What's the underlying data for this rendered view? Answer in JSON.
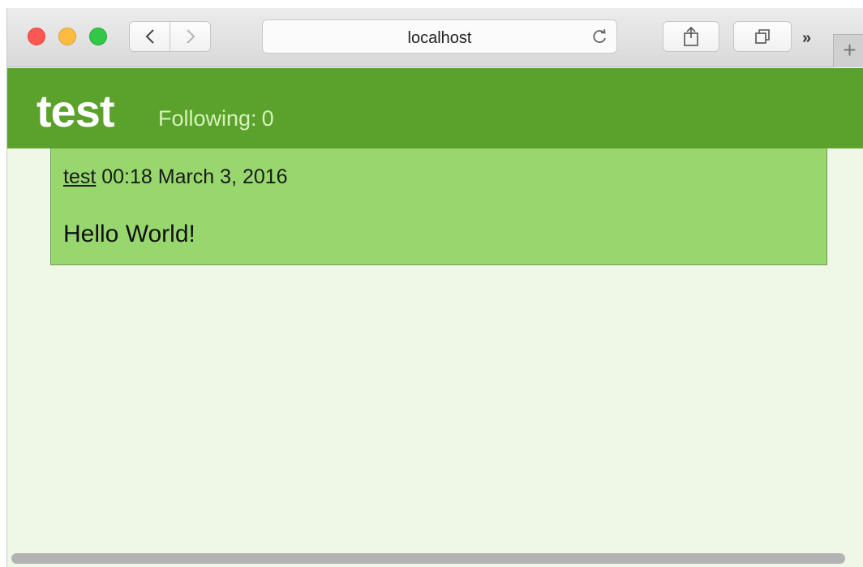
{
  "browser": {
    "address": "localhost",
    "icons": {
      "back": "chevron-left-icon",
      "forward": "chevron-right-icon",
      "reload": "reload-icon",
      "share": "share-icon",
      "tabs": "tabs-icon",
      "more": "double-chevron-icon",
      "new_tab": "plus-icon"
    },
    "more_label": "»",
    "new_tab_label": "+"
  },
  "profile": {
    "username": "test",
    "following_label": "Following:",
    "following_count": "0"
  },
  "posts": [
    {
      "author": "test",
      "timestamp": "00:18 March 3, 2016",
      "body": "Hello World!"
    }
  ],
  "colors": {
    "header": "#5aa22c",
    "post": "#98d76e",
    "page_bg": "#eff7e7"
  }
}
